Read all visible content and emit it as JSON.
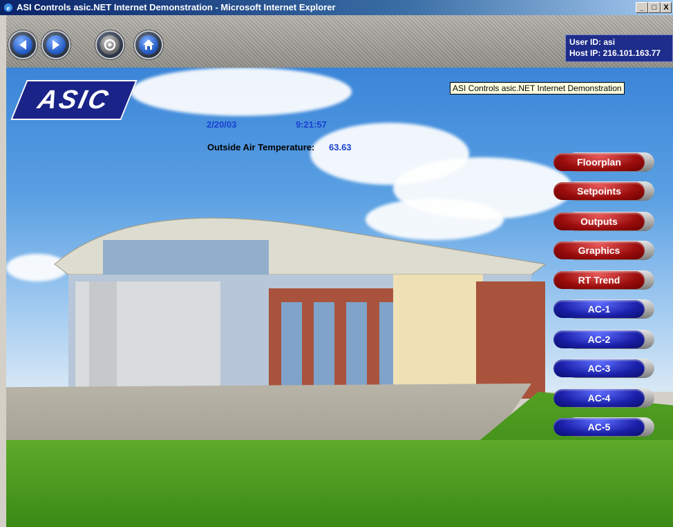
{
  "window": {
    "title": "ASI Controls asic.NET Internet Demonstration - Microsoft Internet Explorer",
    "minimize": "_",
    "maximize": "□",
    "close": "X"
  },
  "toolbar": {
    "back_icon": "back-arrow-icon",
    "forward_icon": "forward-arrow-icon",
    "refresh_icon": "refresh-icon",
    "home_icon": "home-icon"
  },
  "user": {
    "user_id": "User ID: asi",
    "host_ip": "Host IP: 216.101.163.77"
  },
  "logo": {
    "text": "ASIC"
  },
  "status": {
    "date": "2/20/03",
    "time": "9:21:57",
    "oat_label": "Outside Air Temperature:",
    "oat_value": "63.63"
  },
  "tooltip": "ASI Controls asic.NET Internet Demonstration",
  "menu": [
    {
      "label": "Floorplan",
      "color": "red"
    },
    {
      "label": "Setpoints",
      "color": "red"
    },
    {
      "label": "Outputs",
      "color": "red"
    },
    {
      "label": "Graphics",
      "color": "red"
    },
    {
      "label": "RT Trend",
      "color": "red"
    },
    {
      "label": "AC-1",
      "color": "blue"
    },
    {
      "label": "AC-2",
      "color": "blue"
    },
    {
      "label": "AC-3",
      "color": "blue"
    },
    {
      "label": "AC-4",
      "color": "blue"
    },
    {
      "label": "AC-5",
      "color": "blue"
    }
  ],
  "colors": {
    "accent_red": "#9b0d0d",
    "accent_blue": "#1a1fa8",
    "info_text": "#1840d0",
    "user_box": "#1e2d8a"
  }
}
